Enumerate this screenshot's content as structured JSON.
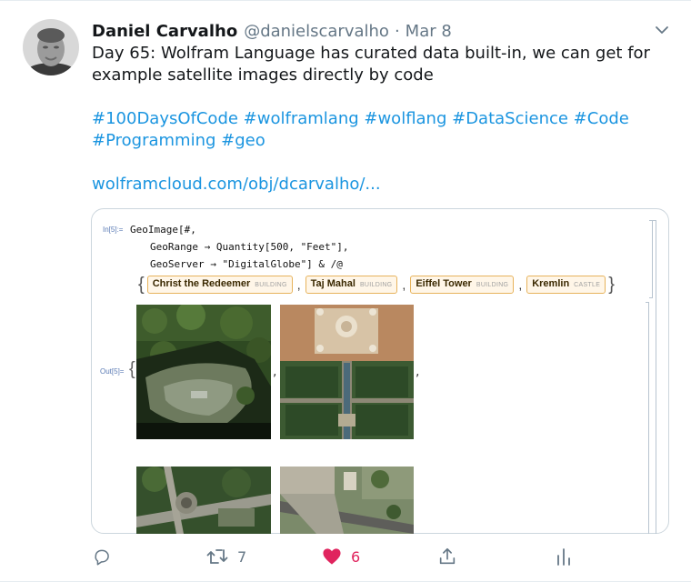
{
  "author": {
    "name": "Daniel Carvalho",
    "handle": "@danielscarvalho",
    "separator": "·",
    "date": "Mar 8"
  },
  "tweet": {
    "text_line1": "Day 65: Wolfram Language has curated data built-in, we can get for",
    "text_line2": "example satellite images directly by code",
    "hashtags_line1": "#100DaysOfCode #wolframlang #wolflang #DataScience #Code",
    "hashtags_line2": "#Programming #geo",
    "link": "wolframcloud.com/obj/dcarvalho/..."
  },
  "notebook": {
    "in_label": "In[5]:=",
    "out_label": "Out[5]=",
    "code_line1": "GeoImage[#,",
    "code_line2": "GeoRange → Quantity[500, \"Feet\"],",
    "code_line3": "GeoServer → \"DigitalGlobe\"] & /@",
    "open_brace": "{",
    "close_brace": "}",
    "comma": ",",
    "entities": [
      {
        "name": "Christ the Redeemer",
        "type": "BUILDING"
      },
      {
        "name": "Taj Mahal",
        "type": "BUILDING"
      },
      {
        "name": "Eiffel Tower",
        "type": "BUILDING"
      },
      {
        "name": "Kremlin",
        "type": "CASTLE"
      }
    ],
    "images": [
      {
        "subject": "Christ the Redeemer satellite image"
      },
      {
        "subject": "Taj Mahal satellite image"
      },
      {
        "subject": "Eiffel Tower satellite image"
      },
      {
        "subject": "Kremlin satellite image"
      }
    ]
  },
  "actions": {
    "reply": {
      "icon": "reply-icon"
    },
    "retweet": {
      "icon": "retweet-icon",
      "count": "7"
    },
    "like": {
      "icon": "heart-icon",
      "count": "6",
      "color": "#e0245e"
    },
    "share": {
      "icon": "share-icon"
    },
    "analytics": {
      "icon": "analytics-icon"
    }
  },
  "colors": {
    "link": "#1b95e0",
    "secondary": "#657786",
    "like": "#e0245e",
    "entity_border": "#e7b35c"
  }
}
